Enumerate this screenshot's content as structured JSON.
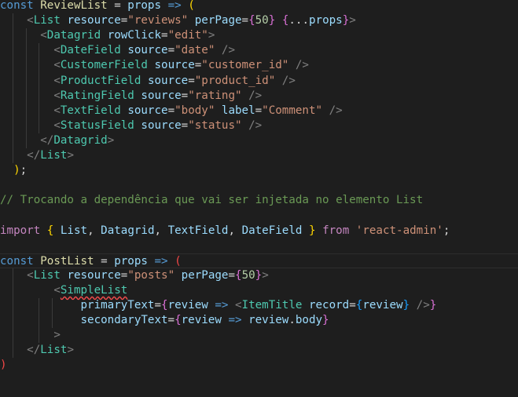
{
  "editor": {
    "lines": [
      [
        [
          "kw",
          "const "
        ],
        [
          "fn",
          "ReviewList"
        ],
        [
          "op",
          " = "
        ],
        [
          "var",
          "props"
        ],
        [
          "op",
          " "
        ],
        [
          "kw",
          "=>"
        ],
        [
          "op",
          " "
        ],
        [
          "p1",
          "("
        ]
      ],
      [
        [
          "op",
          "    "
        ],
        [
          "br",
          "<"
        ],
        [
          "tag",
          "List"
        ],
        [
          "op",
          " "
        ],
        [
          "var",
          "resource"
        ],
        [
          "op",
          "="
        ],
        [
          "str",
          "\"reviews\""
        ],
        [
          "op",
          " "
        ],
        [
          "var",
          "perPage"
        ],
        [
          "op",
          "="
        ],
        [
          "p2",
          "{"
        ],
        [
          "num",
          "50"
        ],
        [
          "p2",
          "}"
        ],
        [
          "op",
          " "
        ],
        [
          "p2",
          "{"
        ],
        [
          "op",
          "..."
        ],
        [
          "var",
          "props"
        ],
        [
          "p2",
          "}"
        ],
        [
          "br",
          ">"
        ]
      ],
      [
        [
          "op",
          "      "
        ],
        [
          "br",
          "<"
        ],
        [
          "tag",
          "Datagrid"
        ],
        [
          "op",
          " "
        ],
        [
          "var",
          "rowClick"
        ],
        [
          "op",
          "="
        ],
        [
          "str",
          "\"edit\""
        ],
        [
          "br",
          ">"
        ]
      ],
      [
        [
          "op",
          "        "
        ],
        [
          "br",
          "<"
        ],
        [
          "tag",
          "DateField"
        ],
        [
          "op",
          " "
        ],
        [
          "var",
          "source"
        ],
        [
          "op",
          "="
        ],
        [
          "str",
          "\"date\""
        ],
        [
          "op",
          " "
        ],
        [
          "br",
          "/>"
        ]
      ],
      [
        [
          "op",
          "        "
        ],
        [
          "br",
          "<"
        ],
        [
          "tag",
          "CustomerField"
        ],
        [
          "op",
          " "
        ],
        [
          "var",
          "source"
        ],
        [
          "op",
          "="
        ],
        [
          "str",
          "\"customer_id\""
        ],
        [
          "op",
          " "
        ],
        [
          "br",
          "/>"
        ]
      ],
      [
        [
          "op",
          "        "
        ],
        [
          "br",
          "<"
        ],
        [
          "tag",
          "ProductField"
        ],
        [
          "op",
          " "
        ],
        [
          "var",
          "source"
        ],
        [
          "op",
          "="
        ],
        [
          "str",
          "\"product_id\""
        ],
        [
          "op",
          " "
        ],
        [
          "br",
          "/>"
        ]
      ],
      [
        [
          "op",
          "        "
        ],
        [
          "br",
          "<"
        ],
        [
          "tag",
          "RatingField"
        ],
        [
          "op",
          " "
        ],
        [
          "var",
          "source"
        ],
        [
          "op",
          "="
        ],
        [
          "str",
          "\"rating\""
        ],
        [
          "op",
          " "
        ],
        [
          "br",
          "/>"
        ]
      ],
      [
        [
          "op",
          "        "
        ],
        [
          "br",
          "<"
        ],
        [
          "tag",
          "TextField"
        ],
        [
          "op",
          " "
        ],
        [
          "var",
          "source"
        ],
        [
          "op",
          "="
        ],
        [
          "str",
          "\"body\""
        ],
        [
          "op",
          " "
        ],
        [
          "var",
          "label"
        ],
        [
          "op",
          "="
        ],
        [
          "str",
          "\"Comment\""
        ],
        [
          "op",
          " "
        ],
        [
          "br",
          "/>"
        ]
      ],
      [
        [
          "op",
          "        "
        ],
        [
          "br",
          "<"
        ],
        [
          "tag",
          "StatusField"
        ],
        [
          "op",
          " "
        ],
        [
          "var",
          "source"
        ],
        [
          "op",
          "="
        ],
        [
          "str",
          "\"status\""
        ],
        [
          "op",
          " "
        ],
        [
          "br",
          "/>"
        ]
      ],
      [
        [
          "op",
          "      "
        ],
        [
          "br",
          "</"
        ],
        [
          "tag",
          "Datagrid"
        ],
        [
          "br",
          ">"
        ]
      ],
      [
        [
          "op",
          "    "
        ],
        [
          "br",
          "</"
        ],
        [
          "tag",
          "List"
        ],
        [
          "br",
          ">"
        ]
      ],
      [
        [
          "op",
          "  "
        ],
        [
          "p1",
          ")"
        ],
        [
          "op",
          ";"
        ]
      ],
      [],
      [
        [
          "cmt",
          "// Trocando a dependência que vai ser injetada no elemento List"
        ]
      ],
      [],
      [
        [
          "ctrl",
          "import"
        ],
        [
          "op",
          " "
        ],
        [
          "p1",
          "{"
        ],
        [
          "op",
          " "
        ],
        [
          "var",
          "List"
        ],
        [
          "op",
          ", "
        ],
        [
          "var",
          "Datagrid"
        ],
        [
          "op",
          ", "
        ],
        [
          "var",
          "TextField"
        ],
        [
          "op",
          ", "
        ],
        [
          "var",
          "DateField"
        ],
        [
          "op",
          " "
        ],
        [
          "p1",
          "}"
        ],
        [
          "op",
          " "
        ],
        [
          "ctrl",
          "from"
        ],
        [
          "op",
          " "
        ],
        [
          "str",
          "'react-admin'"
        ],
        [
          "op",
          ";"
        ]
      ],
      [],
      [
        [
          "kw",
          "const "
        ],
        [
          "fn",
          "PostList"
        ],
        [
          "op",
          " = "
        ],
        [
          "var",
          "props"
        ],
        [
          "op",
          " "
        ],
        [
          "kw",
          "=>"
        ],
        [
          "op",
          " "
        ],
        [
          "err",
          "("
        ]
      ],
      [
        [
          "op",
          "    "
        ],
        [
          "br",
          "<"
        ],
        [
          "tag",
          "List"
        ],
        [
          "op",
          " "
        ],
        [
          "var",
          "resource"
        ],
        [
          "op",
          "="
        ],
        [
          "str",
          "\"posts\""
        ],
        [
          "op",
          " "
        ],
        [
          "var",
          "perPage"
        ],
        [
          "op",
          "="
        ],
        [
          "p2",
          "{"
        ],
        [
          "num",
          "50"
        ],
        [
          "p2",
          "}"
        ],
        [
          "br",
          ">"
        ]
      ],
      [
        [
          "op",
          "        "
        ],
        [
          "br",
          "<"
        ],
        [
          "tag",
          "SimpleList",
          "squiggle"
        ]
      ],
      [
        [
          "op",
          "            "
        ],
        [
          "var",
          "primaryText"
        ],
        [
          "op",
          "="
        ],
        [
          "p2",
          "{"
        ],
        [
          "var",
          "review"
        ],
        [
          "op",
          " "
        ],
        [
          "kw",
          "=>"
        ],
        [
          "op",
          " "
        ],
        [
          "br",
          "<"
        ],
        [
          "tag",
          "ItemTitle"
        ],
        [
          "op",
          " "
        ],
        [
          "var",
          "record"
        ],
        [
          "op",
          "="
        ],
        [
          "p3",
          "{"
        ],
        [
          "var",
          "review"
        ],
        [
          "p3",
          "}"
        ],
        [
          "op",
          " "
        ],
        [
          "br",
          "/>"
        ],
        [
          "p2",
          "}"
        ]
      ],
      [
        [
          "op",
          "            "
        ],
        [
          "var",
          "secondaryText"
        ],
        [
          "op",
          "="
        ],
        [
          "p2",
          "{"
        ],
        [
          "var",
          "review"
        ],
        [
          "op",
          " "
        ],
        [
          "kw",
          "=>"
        ],
        [
          "op",
          " "
        ],
        [
          "var",
          "review"
        ],
        [
          "op",
          "."
        ],
        [
          "var",
          "body"
        ],
        [
          "p2",
          "}"
        ]
      ],
      [
        [
          "op",
          "        "
        ],
        [
          "br",
          ">"
        ]
      ],
      [
        [
          "op",
          "    "
        ],
        [
          "br",
          "</"
        ],
        [
          "tag",
          "List"
        ],
        [
          "br",
          ">"
        ]
      ],
      [
        [
          "err",
          ")"
        ]
      ]
    ]
  }
}
